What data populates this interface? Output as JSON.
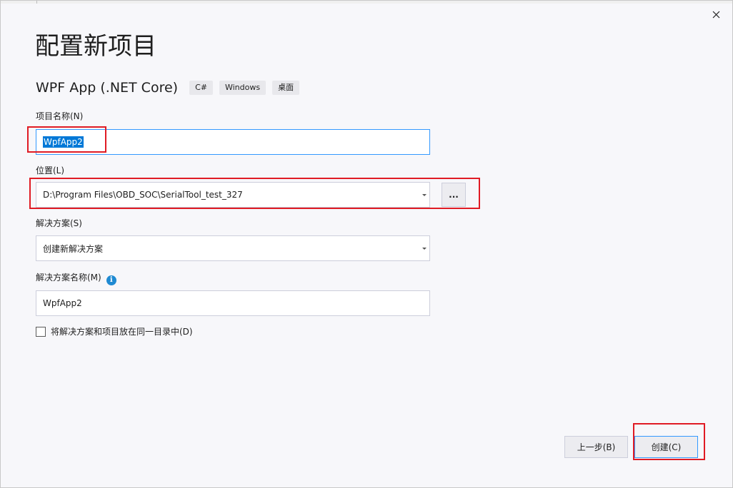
{
  "window": {
    "close_icon": "close-icon"
  },
  "header": {
    "title": "配置新项目",
    "template_name": "WPF App (.NET Core)",
    "tags": [
      "C#",
      "Windows",
      "桌面"
    ]
  },
  "form": {
    "project_name_label": "项目名称(N)",
    "project_name_value": "WpfApp2",
    "location_label": "位置(L)",
    "location_value": "D:\\Program Files\\OBD_SOC\\SerialTool_test_327",
    "browse_label": "...",
    "solution_label": "解决方案(S)",
    "solution_value": "创建新解决方案",
    "solution_name_label": "解决方案名称(M)",
    "solution_name_value": "WpfApp2",
    "info_icon": "info-icon",
    "same_dir_checkbox_label": "将解决方案和项目放在同一目录中(D)",
    "same_dir_checked": false
  },
  "footer": {
    "back_label": "上一步(B)",
    "create_label": "创建(C)"
  },
  "colors": {
    "annotation": "#e01b24",
    "focus": "#3399ff",
    "selection": "#0078d7",
    "info": "#1f8ad2"
  }
}
